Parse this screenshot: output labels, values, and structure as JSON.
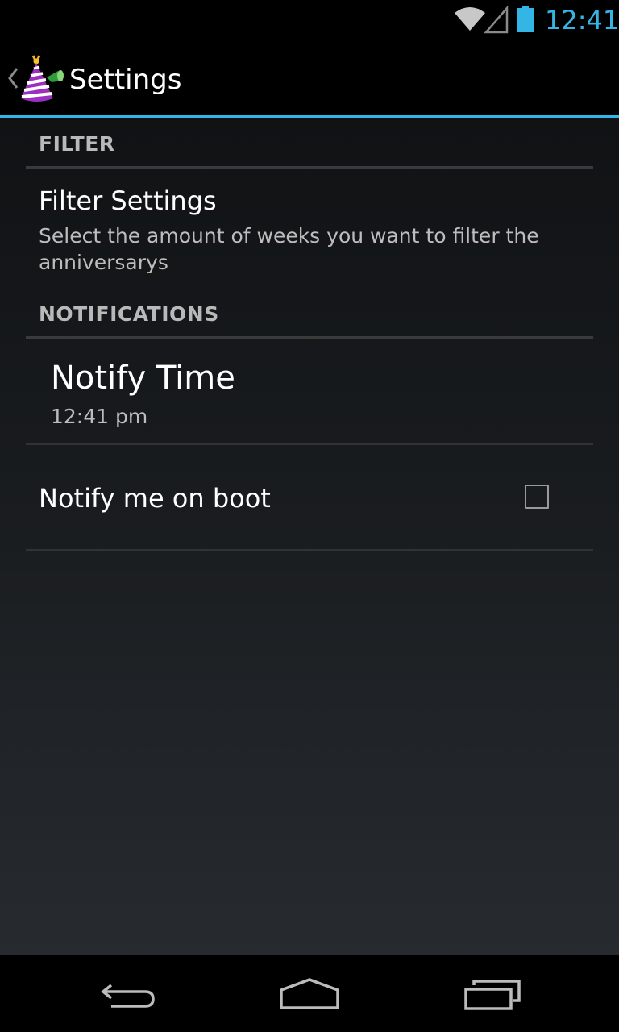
{
  "status_bar": {
    "time": "12:41",
    "accent_color": "#33b5e5",
    "icons": [
      "wifi-icon",
      "cell-signal-icon",
      "battery-icon"
    ]
  },
  "action_bar": {
    "title": "Settings",
    "up_icon": "chevron-left-icon",
    "app_icon": "party-hat-icon"
  },
  "sections": {
    "filter": {
      "header": "FILTER",
      "filter_settings": {
        "title": "Filter Settings",
        "summary": "Select the amount of weeks you want to filter the anniversarys"
      }
    },
    "notifications": {
      "header": "NOTIFICATIONS",
      "notify_time": {
        "title": "Notify Time",
        "summary": "12:41 pm"
      },
      "notify_boot": {
        "title": "Notify me on boot",
        "checked": false
      }
    }
  },
  "nav_bar": {
    "icons": [
      "back-icon",
      "home-icon",
      "recent-apps-icon"
    ]
  }
}
